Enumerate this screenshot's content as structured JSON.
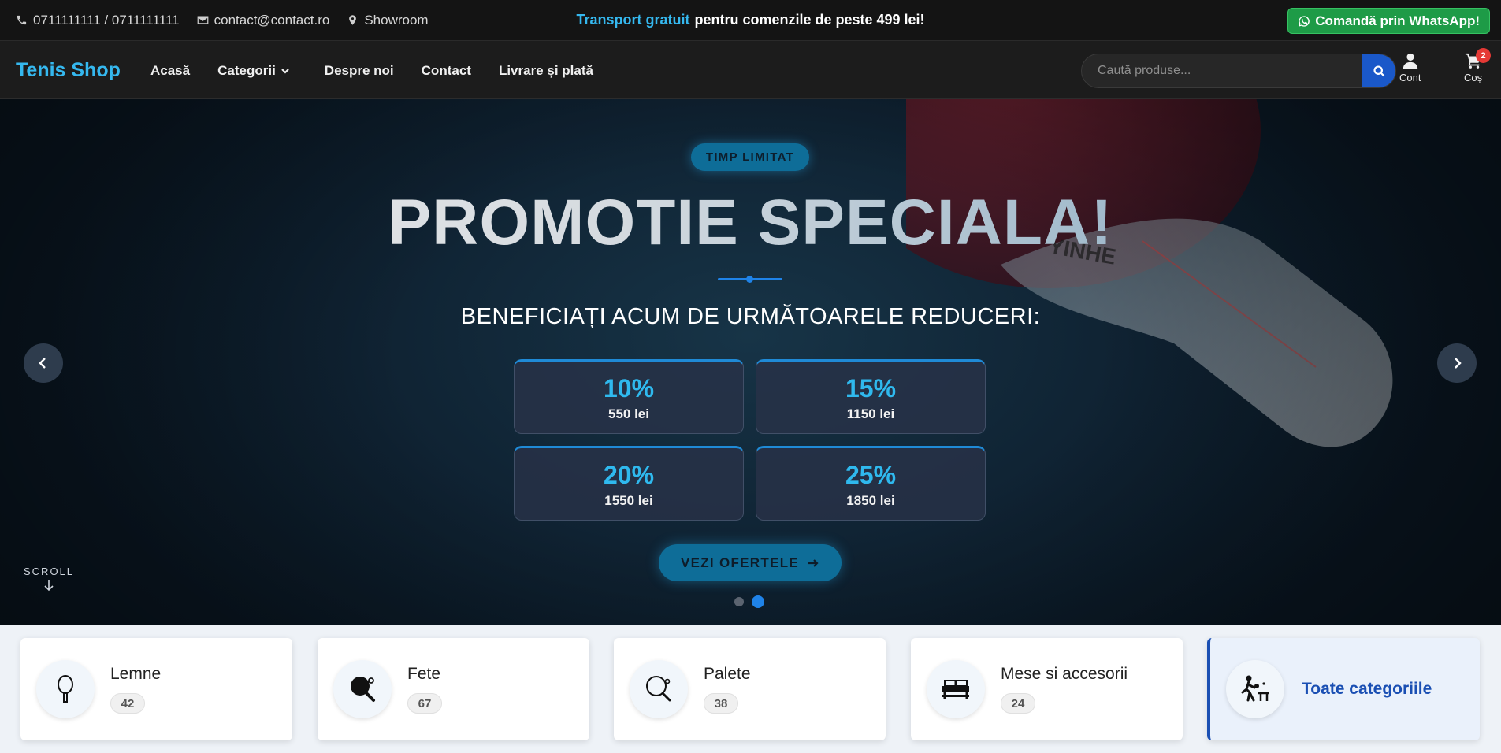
{
  "topbar": {
    "phone": "0711111111 / 0711111111",
    "email": "contact@contact.ro",
    "showroom": "Showroom",
    "promo_highlight": "Transport gratuit",
    "promo_rest": "pentru comenzile de peste 499 lei!",
    "whatsapp_label": "Comandă prin WhatsApp!"
  },
  "header": {
    "logo": "Tenis Shop",
    "nav": [
      "Acasă",
      "Categorii",
      "Despre noi",
      "Contact",
      "Livrare și plată"
    ],
    "search_placeholder": "Caută produse...",
    "account_label": "Cont",
    "cart_label": "Coș",
    "cart_count": "2"
  },
  "hero": {
    "tag": "TIMP LIMITAT",
    "title": "PROMOTIE SPECIALA!",
    "subtitle": "BENEFICIAȚI ACUM DE URMĂTOARELE REDUCERI:",
    "discounts": [
      {
        "percent": "10%",
        "amount": "550 lei"
      },
      {
        "percent": "15%",
        "amount": "1150 lei"
      },
      {
        "percent": "20%",
        "amount": "1550 lei"
      },
      {
        "percent": "25%",
        "amount": "1850 lei"
      }
    ],
    "cta": "VEZI OFERTELE",
    "scroll_label": "SCROLL",
    "active_slide": 2,
    "slide_count": 2
  },
  "categories": [
    {
      "name": "Lemne",
      "count": "42",
      "icon": "paddle-blade-icon"
    },
    {
      "name": "Fete",
      "count": "67",
      "icon": "paddle-rubber-icon"
    },
    {
      "name": "Palete",
      "count": "38",
      "icon": "paddle-icon"
    },
    {
      "name": "Mese si accesorii",
      "count": "24",
      "icon": "table-icon"
    }
  ],
  "all_categories_label": "Toate categoriile",
  "colors": {
    "accent": "#35b8ef",
    "primary_blue": "#1a4fb3",
    "whatsapp_green": "#1e9b47",
    "badge_red": "#e53935"
  }
}
